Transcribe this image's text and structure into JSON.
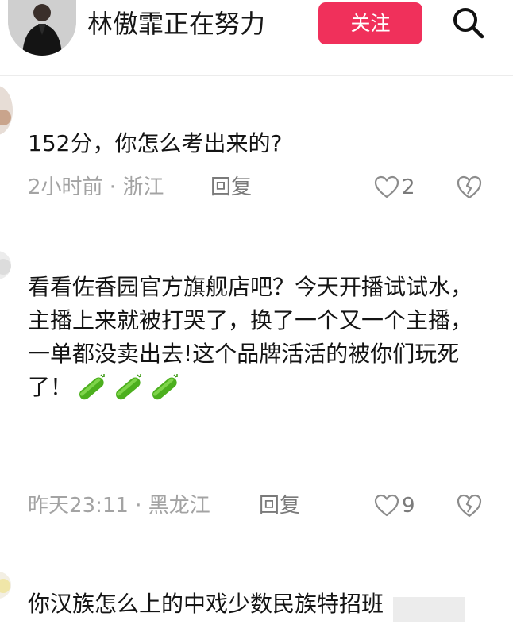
{
  "header": {
    "username": "林傲霏正在努力",
    "follow_label": "关注"
  },
  "comments": [
    {
      "text": "152分，你怎么考出来的?",
      "time": "2小时前",
      "location": "浙江",
      "reply_label": "回复",
      "likes": "2"
    },
    {
      "text": "看看佐香园官方旗舰店吧？今天开播试试水，主播上来就被打哭了，换了一个又一个主播，一单都没卖出去!这个品牌活活的被你们玩死了！",
      "emoji": "cucumber",
      "time": "昨天23:11",
      "location": "黑龙江",
      "reply_label": "回复",
      "likes": "9"
    },
    {
      "text": "你汉族怎么上的中戏少数民族特招班"
    }
  ],
  "meta_separator": " · ",
  "colors": {
    "follow": "#f0305b",
    "muted": "#a3a3a3",
    "text": "#141414"
  }
}
